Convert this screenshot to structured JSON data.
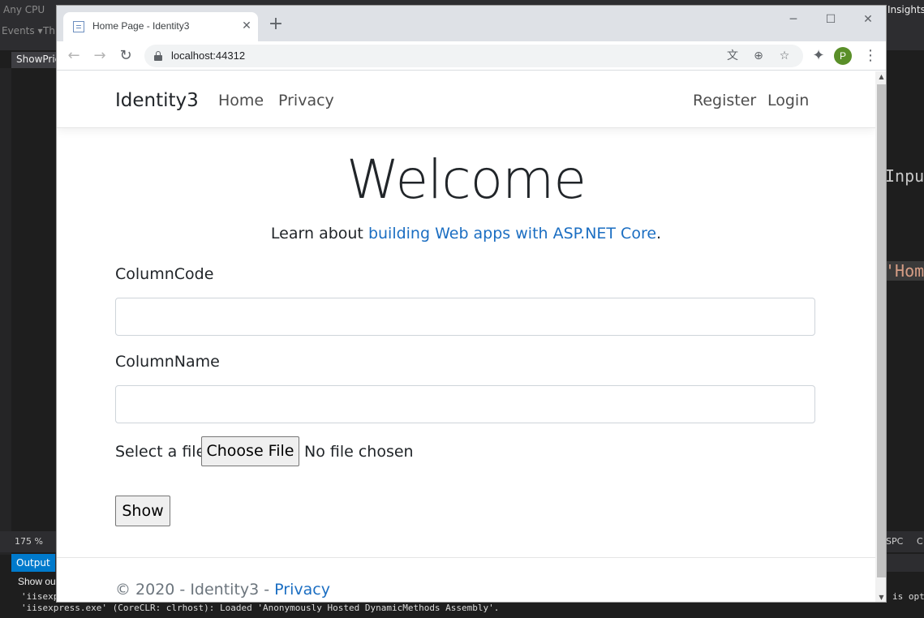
{
  "ide": {
    "top_left_text": "Any CPU",
    "events_text": "Events ▾",
    "threads_text": "Thr",
    "insights_text": "Insights",
    "editor_tab": "ShowPrice",
    "code_lines": [
      "Inpu",
      "'Hom"
    ],
    "zoom_level": "175 %",
    "status_right_1": "SPC",
    "status_right_2": "C",
    "output_tab": "Output",
    "show_output_from": "Show out",
    "output_lines": [
      "'iisexp",
      "'iisexpress.exe' (CoreCLR: clrhost): Loaded 'Anonymously Hosted DynamicMethods Assembly'.",
      "is opti"
    ]
  },
  "browser": {
    "tab_title": "Home Page - Identity3",
    "url": "localhost:44312",
    "profile_initial": "P",
    "profile_color": "#5a8f29"
  },
  "page": {
    "brand": "Identity3",
    "nav_left": [
      "Home",
      "Privacy"
    ],
    "nav_right": [
      "Register",
      "Login"
    ],
    "heading": "Welcome",
    "learn_prefix": "Learn about ",
    "learn_link": "building Web apps with ASP.NET Core",
    "learn_suffix": ".",
    "field1_label": "ColumnCode",
    "field1_value": "",
    "field2_label": "ColumnName",
    "field2_value": "",
    "file_label": "Select a file",
    "file_button": "Choose File",
    "file_status": "No file chosen",
    "submit_button": "Show",
    "footer_text": "© 2020 - Identity3 - ",
    "footer_link": "Privacy",
    "link_color": "#1b6ec2"
  }
}
